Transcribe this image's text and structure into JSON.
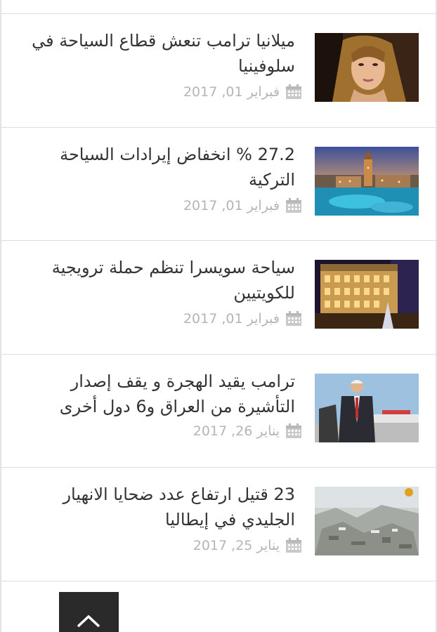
{
  "articles": [
    {
      "title": "ميلانيا ترامب تنعش قطاع السياحة في سلوفينيا",
      "date": "فبراير 01, 2017",
      "image": "portrait-woman-photo"
    },
    {
      "title": "27.2 % انخفاض إيرادات السياحة التركية",
      "date": "فبراير 01, 2017",
      "image": "resort-pool-tower-photo"
    },
    {
      "title": "سياحة سويسرا تنظم حملة ترويجية للكويتيين",
      "date": "فبراير 01, 2017",
      "image": "hotel-building-night-photo"
    },
    {
      "title": "ترامب يقيد الهجرة و يقف إصدار التأشيرة من العراق و6 دول أخرى",
      "date": "يناير 26, 2017",
      "image": "man-at-airport-photo"
    },
    {
      "title": "23 قتيل ارتفاع عدد ضحايا الانهيار الجليدي في إيطاليا",
      "date": "يناير 25, 2017",
      "image": "avalanche-rubble-photo"
    }
  ],
  "icons": {
    "date": "calendar-icon",
    "back_to_top": "chevron-up-icon"
  },
  "colors": {
    "title": "#333333",
    "date": "#b5b5b5",
    "separator": "#dedede",
    "button": "#2a2a2a"
  }
}
